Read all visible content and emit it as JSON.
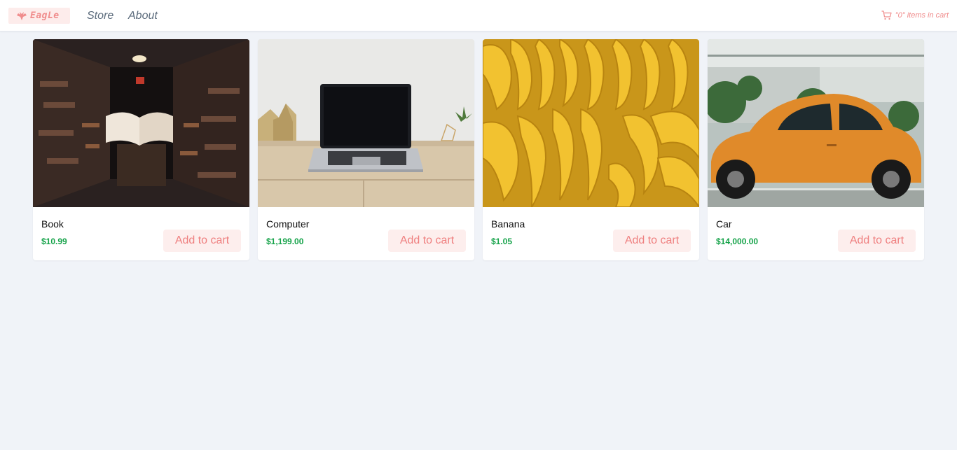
{
  "header": {
    "brand": "EagLe",
    "nav": [
      {
        "label": "Store"
      },
      {
        "label": "About"
      }
    ],
    "cart": {
      "text": "\"0\" items in cart",
      "icon": "cart-icon"
    }
  },
  "colors": {
    "accent": "#f08c8c",
    "price": "#16a34a",
    "background": "#f0f3f8"
  },
  "products": [
    {
      "name": "Book",
      "price": "$10.99",
      "button": "Add to cart",
      "image": "book-library-photo"
    },
    {
      "name": "Computer",
      "price": "$1,199.00",
      "button": "Add to cart",
      "image": "laptop-desk-photo"
    },
    {
      "name": "Banana",
      "price": "$1.05",
      "button": "Add to cart",
      "image": "bananas-photo"
    },
    {
      "name": "Car",
      "price": "$14,000.00",
      "button": "Add to cart",
      "image": "orange-beetle-car-photo"
    }
  ]
}
